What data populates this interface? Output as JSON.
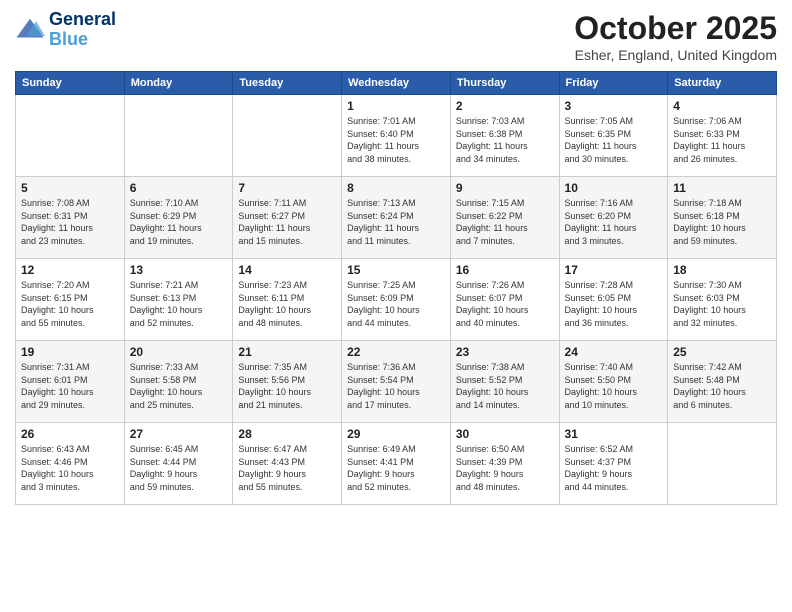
{
  "logo": {
    "line1": "General",
    "line2": "Blue"
  },
  "title": "October 2025",
  "location": "Esher, England, United Kingdom",
  "weekdays": [
    "Sunday",
    "Monday",
    "Tuesday",
    "Wednesday",
    "Thursday",
    "Friday",
    "Saturday"
  ],
  "weeks": [
    [
      {
        "day": "",
        "info": ""
      },
      {
        "day": "",
        "info": ""
      },
      {
        "day": "",
        "info": ""
      },
      {
        "day": "1",
        "info": "Sunrise: 7:01 AM\nSunset: 6:40 PM\nDaylight: 11 hours\nand 38 minutes."
      },
      {
        "day": "2",
        "info": "Sunrise: 7:03 AM\nSunset: 6:38 PM\nDaylight: 11 hours\nand 34 minutes."
      },
      {
        "day": "3",
        "info": "Sunrise: 7:05 AM\nSunset: 6:35 PM\nDaylight: 11 hours\nand 30 minutes."
      },
      {
        "day": "4",
        "info": "Sunrise: 7:06 AM\nSunset: 6:33 PM\nDaylight: 11 hours\nand 26 minutes."
      }
    ],
    [
      {
        "day": "5",
        "info": "Sunrise: 7:08 AM\nSunset: 6:31 PM\nDaylight: 11 hours\nand 23 minutes."
      },
      {
        "day": "6",
        "info": "Sunrise: 7:10 AM\nSunset: 6:29 PM\nDaylight: 11 hours\nand 19 minutes."
      },
      {
        "day": "7",
        "info": "Sunrise: 7:11 AM\nSunset: 6:27 PM\nDaylight: 11 hours\nand 15 minutes."
      },
      {
        "day": "8",
        "info": "Sunrise: 7:13 AM\nSunset: 6:24 PM\nDaylight: 11 hours\nand 11 minutes."
      },
      {
        "day": "9",
        "info": "Sunrise: 7:15 AM\nSunset: 6:22 PM\nDaylight: 11 hours\nand 7 minutes."
      },
      {
        "day": "10",
        "info": "Sunrise: 7:16 AM\nSunset: 6:20 PM\nDaylight: 11 hours\nand 3 minutes."
      },
      {
        "day": "11",
        "info": "Sunrise: 7:18 AM\nSunset: 6:18 PM\nDaylight: 10 hours\nand 59 minutes."
      }
    ],
    [
      {
        "day": "12",
        "info": "Sunrise: 7:20 AM\nSunset: 6:15 PM\nDaylight: 10 hours\nand 55 minutes."
      },
      {
        "day": "13",
        "info": "Sunrise: 7:21 AM\nSunset: 6:13 PM\nDaylight: 10 hours\nand 52 minutes."
      },
      {
        "day": "14",
        "info": "Sunrise: 7:23 AM\nSunset: 6:11 PM\nDaylight: 10 hours\nand 48 minutes."
      },
      {
        "day": "15",
        "info": "Sunrise: 7:25 AM\nSunset: 6:09 PM\nDaylight: 10 hours\nand 44 minutes."
      },
      {
        "day": "16",
        "info": "Sunrise: 7:26 AM\nSunset: 6:07 PM\nDaylight: 10 hours\nand 40 minutes."
      },
      {
        "day": "17",
        "info": "Sunrise: 7:28 AM\nSunset: 6:05 PM\nDaylight: 10 hours\nand 36 minutes."
      },
      {
        "day": "18",
        "info": "Sunrise: 7:30 AM\nSunset: 6:03 PM\nDaylight: 10 hours\nand 32 minutes."
      }
    ],
    [
      {
        "day": "19",
        "info": "Sunrise: 7:31 AM\nSunset: 6:01 PM\nDaylight: 10 hours\nand 29 minutes."
      },
      {
        "day": "20",
        "info": "Sunrise: 7:33 AM\nSunset: 5:58 PM\nDaylight: 10 hours\nand 25 minutes."
      },
      {
        "day": "21",
        "info": "Sunrise: 7:35 AM\nSunset: 5:56 PM\nDaylight: 10 hours\nand 21 minutes."
      },
      {
        "day": "22",
        "info": "Sunrise: 7:36 AM\nSunset: 5:54 PM\nDaylight: 10 hours\nand 17 minutes."
      },
      {
        "day": "23",
        "info": "Sunrise: 7:38 AM\nSunset: 5:52 PM\nDaylight: 10 hours\nand 14 minutes."
      },
      {
        "day": "24",
        "info": "Sunrise: 7:40 AM\nSunset: 5:50 PM\nDaylight: 10 hours\nand 10 minutes."
      },
      {
        "day": "25",
        "info": "Sunrise: 7:42 AM\nSunset: 5:48 PM\nDaylight: 10 hours\nand 6 minutes."
      }
    ],
    [
      {
        "day": "26",
        "info": "Sunrise: 6:43 AM\nSunset: 4:46 PM\nDaylight: 10 hours\nand 3 minutes."
      },
      {
        "day": "27",
        "info": "Sunrise: 6:45 AM\nSunset: 4:44 PM\nDaylight: 9 hours\nand 59 minutes."
      },
      {
        "day": "28",
        "info": "Sunrise: 6:47 AM\nSunset: 4:43 PM\nDaylight: 9 hours\nand 55 minutes."
      },
      {
        "day": "29",
        "info": "Sunrise: 6:49 AM\nSunset: 4:41 PM\nDaylight: 9 hours\nand 52 minutes."
      },
      {
        "day": "30",
        "info": "Sunrise: 6:50 AM\nSunset: 4:39 PM\nDaylight: 9 hours\nand 48 minutes."
      },
      {
        "day": "31",
        "info": "Sunrise: 6:52 AM\nSunset: 4:37 PM\nDaylight: 9 hours\nand 44 minutes."
      },
      {
        "day": "",
        "info": ""
      }
    ]
  ]
}
